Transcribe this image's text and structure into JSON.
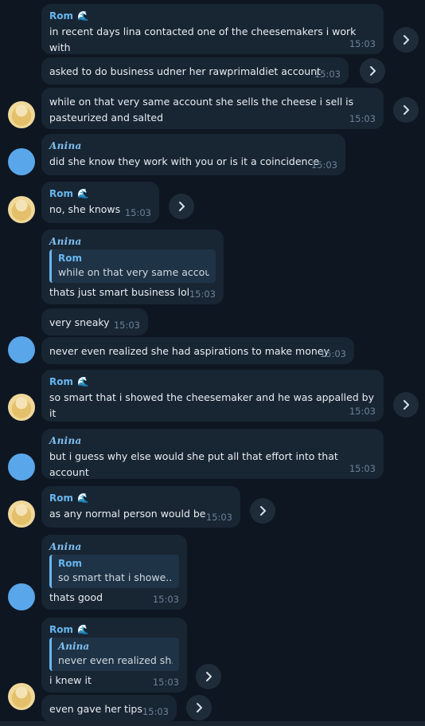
{
  "messages": [
    {
      "sender": "Rom",
      "text": "in recent days lina contacted one of the cheesemakers i work with",
      "time": "15:03"
    },
    {
      "text": "asked to do business udner her rawprimaldiet account",
      "time": "15:03"
    },
    {
      "text": "while on that very same account she sells the cheese i sell is\npasteurized and salted",
      "time": "15:03"
    },
    {
      "sender": "Anina",
      "text": "did she know they work with you or is it a coincidence",
      "time": "15:03"
    },
    {
      "sender": "Rom",
      "text": "no, she knows",
      "time": "15:03"
    },
    {
      "sender": "Anina",
      "reply": {
        "name": "Rom",
        "text": "while on that very same accou..."
      },
      "text": "thats just smart business lol",
      "time": "15:03"
    },
    {
      "text": "very sneaky",
      "time": "15:03"
    },
    {
      "text": "never even realized she had aspirations to make money",
      "time": "15:03"
    },
    {
      "sender": "Rom",
      "text": "so smart that i showed the cheesemaker and he was appalled by it",
      "time": "15:03"
    },
    {
      "sender": "Anina",
      "text": "but i guess why else would she put all that effort into that account",
      "time": "15:03"
    },
    {
      "sender": "Rom",
      "text": "as any normal person would be",
      "time": "15:03"
    },
    {
      "sender": "Anina",
      "reply": {
        "name": "Rom",
        "text": "so smart that i showe..."
      },
      "text": "thats good",
      "time": "15:03"
    },
    {
      "sender": "Rom",
      "reply": {
        "name": "Anina",
        "text": "never even realized sh..."
      },
      "text": "i knew it",
      "time": "15:03"
    },
    {
      "text": "even gave her tips",
      "time": "15:03"
    }
  ],
  "icons": {
    "forward": "forward-chevron-icon",
    "sender_badge": "wave-icon"
  },
  "colors": {
    "background": "#0e1621",
    "bubble": "#182533",
    "accent": "#67b7f0",
    "time": "#6c8296"
  }
}
